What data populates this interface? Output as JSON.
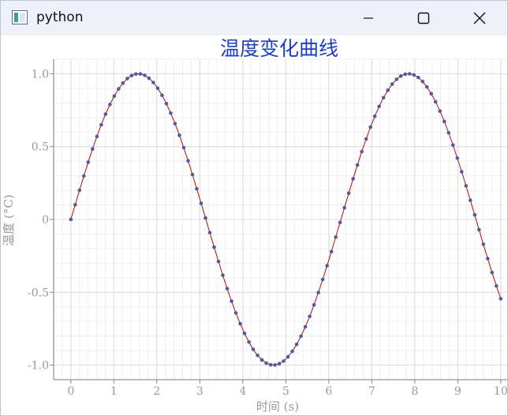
{
  "window": {
    "title": "python",
    "icon": "python-app-icon",
    "controls": [
      "minimize-icon",
      "maximize-icon",
      "close-icon"
    ]
  },
  "colors": {
    "title": "#1a3fd0",
    "line": "#cc0000",
    "marker": "#4b5ba8",
    "axis_text": "#999999",
    "grid_major": "#dcdcdc",
    "grid_minor": "#efefef"
  },
  "chart_data": {
    "type": "line",
    "title": "温度变化曲线",
    "xlabel": "时间 (s)",
    "ylabel": "温度 (°C)",
    "xlim": [
      -0.4,
      10.15
    ],
    "ylim": [
      -1.1,
      1.1
    ],
    "grid": true,
    "minor_grid": true,
    "x_ticks": [
      0,
      1,
      2,
      3,
      4,
      5,
      6,
      7,
      8,
      9,
      10
    ],
    "x_tick_labels": [
      "0",
      "1",
      "2",
      "3",
      "4",
      "5",
      "6",
      "7",
      "8",
      "9",
      "10"
    ],
    "y_ticks": [
      1.0,
      0.5,
      0,
      -0.5,
      -1.0
    ],
    "y_tick_labels": [
      "1.0",
      "0.5",
      "0",
      "-0.5",
      "-1.0"
    ],
    "series": [
      {
        "function": "sin(x)",
        "x_start": 0,
        "x_end": 10,
        "num_points": 100,
        "color": "#cc0000",
        "marker": "circle",
        "marker_color": "#4b5ba8"
      }
    ]
  }
}
